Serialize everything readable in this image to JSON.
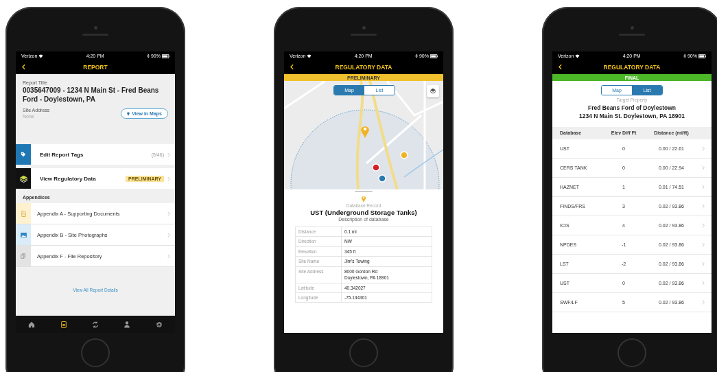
{
  "report_screen": {
    "status_bar": {
      "carrier": "Verizon",
      "time": "4:20 PM",
      "battery": "90%"
    },
    "nav_title": "REPORT",
    "report_title_label": "Report Title",
    "report_title": "0035647009 - 1234 N Main St - Fred Beans Ford - Doylestown, PA",
    "site_address_label": "Site Address",
    "site_address": "None",
    "maps_button": "View in Maps",
    "actions": [
      {
        "kind": "tags",
        "label": "Edit Report Tags",
        "count": "(5/46)"
      },
      {
        "kind": "regulatory",
        "label": "View Regulatory Data",
        "badge": "PRELIMINARY"
      }
    ],
    "section_header": "Appendices",
    "appendices": [
      {
        "kind": "document",
        "label": "Appendix A - Supporting Documents"
      },
      {
        "kind": "photo",
        "label": "Appendix B - Site Photographs"
      },
      {
        "kind": "files",
        "label": "Appendix F - File Repository"
      }
    ],
    "details_link": "View All Report Details",
    "tab_bar": [
      {
        "kind": "home",
        "selected": false
      },
      {
        "kind": "report",
        "selected": true
      },
      {
        "kind": "sync",
        "selected": false
      },
      {
        "kind": "profile",
        "selected": false
      },
      {
        "kind": "settings",
        "selected": false
      }
    ]
  },
  "map_screen": {
    "status_bar": {
      "carrier": "Verizon",
      "time": "4:20 PM",
      "battery": "90%"
    },
    "nav_title": "REGULATORY DATA",
    "banner": {
      "kind": "preliminary",
      "text": "PRELIMINARY"
    },
    "segments": [
      {
        "label": "Map",
        "selected": true
      },
      {
        "label": "List",
        "selected": false
      }
    ],
    "record_label": "Database Record",
    "record_title": "UST (Underground Storage Tanks)",
    "record_description": "Description of database",
    "details": [
      {
        "label": "Distance",
        "value": "0.1 mi"
      },
      {
        "label": "Direction",
        "value": "NW"
      },
      {
        "label": "Elevation",
        "value": "345 ft"
      },
      {
        "label": "Site Name",
        "value": "Jim's Towing"
      },
      {
        "label": "Site Address",
        "value": "8000 Gordon Rd\nDoylestown, PA 18901"
      },
      {
        "label": "Latitude",
        "value": "40.342027"
      },
      {
        "label": "Longitude",
        "value": "-75.134301"
      }
    ]
  },
  "list_screen": {
    "status_bar": {
      "carrier": "Verizon",
      "time": "4:20 PM",
      "battery": "90%"
    },
    "nav_title": "REGULATORY DATA",
    "banner": {
      "kind": "final",
      "text": "FINAL"
    },
    "segments": [
      {
        "label": "Map",
        "selected": false
      },
      {
        "label": "List",
        "selected": true
      }
    ],
    "target_label": "Target Property",
    "target_name": "Fred Beans Ford of Doylestown",
    "target_address": "1234 N Main St. Doylestown, PA 18901",
    "columns": [
      "Database",
      "Elev Diff Ft",
      "Distance (mi/ft)"
    ],
    "rows": [
      {
        "database": "UST",
        "elev_diff": "0",
        "distance": "0.00 / 22.61"
      },
      {
        "database": "CERS TANK",
        "elev_diff": "0",
        "distance": "0.00 / 22.94"
      },
      {
        "database": "HAZNET",
        "elev_diff": "1",
        "distance": "0.01 / 74.51"
      },
      {
        "database": "FINDS/FRS",
        "elev_diff": "3",
        "distance": "0.02 / 93.86"
      },
      {
        "database": "ICIS",
        "elev_diff": "4",
        "distance": "0.02 / 93.86"
      },
      {
        "database": "NPDES",
        "elev_diff": "-1",
        "distance": "0.02 / 93.86"
      },
      {
        "database": "LST",
        "elev_diff": "-2",
        "distance": "0.02 / 93.86"
      },
      {
        "database": "UST",
        "elev_diff": "0",
        "distance": "0.02 / 93.86"
      },
      {
        "database": "SWF/LF",
        "elev_diff": "5",
        "distance": "0.02 / 93.86"
      }
    ]
  }
}
